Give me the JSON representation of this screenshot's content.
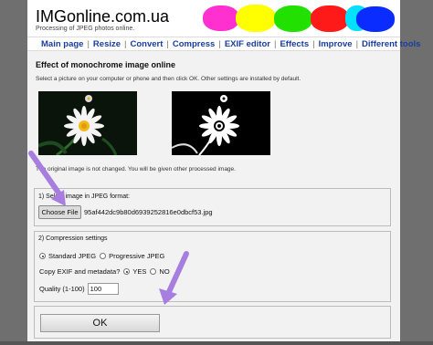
{
  "header": {
    "title": "IMGonline.com.ua",
    "subtitle": "Processing of JPEG photos online."
  },
  "nav": {
    "items": [
      "Main page",
      "Resize",
      "Convert",
      "Compress",
      "EXIF editor",
      "Effects",
      "Improve",
      "Different tools"
    ]
  },
  "main": {
    "heading": "Effect of monochrome image online",
    "intro": "Select a picture on your computer or phone and then click OK. Other settings are installed by default.",
    "note": "The original image is not changed. You will be given other processed image."
  },
  "step1": {
    "title": "1) Select image in JPEG format:",
    "button_label": "Choose File",
    "file_name": "95af442dc9b80d6939252816e0dbcf53.jpg"
  },
  "step2": {
    "title": "2) Compression settings",
    "options": [
      "Standard JPEG",
      "Progressive JPEG"
    ],
    "selected_option": "Standard JPEG",
    "exif_label": "Copy EXIF and metadata?",
    "exif_options": [
      "YES",
      "NO"
    ],
    "exif_selected": "YES",
    "quality_label": "Quality (1-100)",
    "quality_value": "100"
  },
  "submit": {
    "label": "OK"
  },
  "colors": {
    "nav_link": "#1a3ea0",
    "arrow": "#a77ee0",
    "blobs": [
      "#ff2fd0",
      "#ffff00",
      "#22e000",
      "#ff1a1a",
      "#00e0ff",
      "#0a2cff"
    ]
  }
}
